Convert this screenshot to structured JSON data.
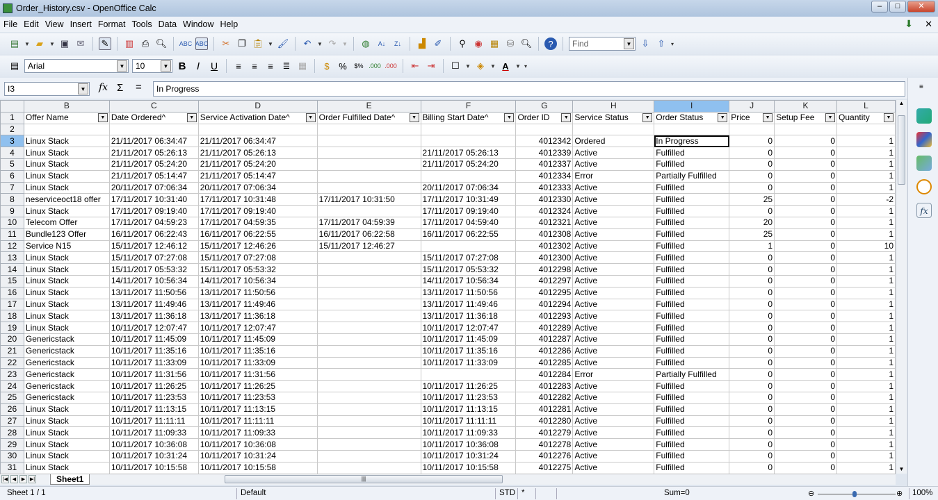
{
  "window": {
    "title": "Order_History.csv - OpenOffice Calc",
    "minimize": "–",
    "maximize": "□",
    "close": "✕"
  },
  "menu": [
    "File",
    "Edit",
    "View",
    "Insert",
    "Format",
    "Tools",
    "Data",
    "Window",
    "Help"
  ],
  "toolbar": {
    "find_placeholder": "Find",
    "font_name": "Arial",
    "font_size": "10",
    "bold": "B",
    "italic": "I",
    "underline": "U"
  },
  "formula_bar": {
    "cell_ref": "I3",
    "fx": "fx",
    "sigma": "Σ",
    "equals": "=",
    "content": "In Progress"
  },
  "columns": [
    "B",
    "C",
    "D",
    "E",
    "F",
    "G",
    "H",
    "I",
    "J",
    "K",
    "L"
  ],
  "headers": [
    "Offer Name",
    "Date Ordered^",
    "Service Activation Date^",
    "Order Fulfilled Date^",
    "Billing Start Date^",
    "Order ID",
    "Service Status",
    "Order Status",
    "Price",
    "Setup Fee",
    "Quantity"
  ],
  "rows": [
    [
      "Linux Stack",
      "21/11/2017 06:34:47",
      "21/11/2017 06:34:47",
      "",
      "",
      "4012342",
      "Ordered",
      "In Progress",
      "0",
      "0",
      "1"
    ],
    [
      "Linux Stack",
      "21/11/2017 05:26:13",
      "21/11/2017 05:26:13",
      "",
      "21/11/2017 05:26:13",
      "4012339",
      "Active",
      "Fulfilled",
      "0",
      "0",
      "1"
    ],
    [
      "Linux Stack",
      "21/11/2017 05:24:20",
      "21/11/2017 05:24:20",
      "",
      "21/11/2017 05:24:20",
      "4012337",
      "Active",
      "Fulfilled",
      "0",
      "0",
      "1"
    ],
    [
      "Linux Stack",
      "21/11/2017 05:14:47",
      "21/11/2017 05:14:47",
      "",
      "",
      "4012334",
      "Error",
      "Partially Fulfilled",
      "0",
      "0",
      "1"
    ],
    [
      "Linux Stack",
      "20/11/2017 07:06:34",
      "20/11/2017 07:06:34",
      "",
      "20/11/2017 07:06:34",
      "4012333",
      "Active",
      "Fulfilled",
      "0",
      "0",
      "1"
    ],
    [
      "neserviceoct18 offer",
      "17/11/2017 10:31:40",
      "17/11/2017 10:31:48",
      "17/11/2017 10:31:50",
      "17/11/2017 10:31:49",
      "4012330",
      "Active",
      "Fulfilled",
      "25",
      "0",
      "-2"
    ],
    [
      "Linux Stack",
      "17/11/2017 09:19:40",
      "17/11/2017 09:19:40",
      "",
      "17/11/2017 09:19:40",
      "4012324",
      "Active",
      "Fulfilled",
      "0",
      "0",
      "1"
    ],
    [
      "Telecom Offer",
      "17/11/2017 04:59:23",
      "17/11/2017 04:59:35",
      "17/11/2017 04:59:39",
      "17/11/2017 04:59:40",
      "4012321",
      "Active",
      "Fulfilled",
      "20",
      "0",
      "1"
    ],
    [
      "Bundle123 Offer",
      "16/11/2017 06:22:43",
      "16/11/2017 06:22:55",
      "16/11/2017 06:22:58",
      "16/11/2017 06:22:55",
      "4012308",
      "Active",
      "Fulfilled",
      "25",
      "0",
      "1"
    ],
    [
      "Service N15",
      "15/11/2017 12:46:12",
      "15/11/2017 12:46:26",
      "15/11/2017 12:46:27",
      "",
      "4012302",
      "Active",
      "Fulfilled",
      "1",
      "0",
      "10"
    ],
    [
      "Linux Stack",
      "15/11/2017 07:27:08",
      "15/11/2017 07:27:08",
      "",
      "15/11/2017 07:27:08",
      "4012300",
      "Active",
      "Fulfilled",
      "0",
      "0",
      "1"
    ],
    [
      "Linux Stack",
      "15/11/2017 05:53:32",
      "15/11/2017 05:53:32",
      "",
      "15/11/2017 05:53:32",
      "4012298",
      "Active",
      "Fulfilled",
      "0",
      "0",
      "1"
    ],
    [
      "Linux Stack",
      "14/11/2017 10:56:34",
      "14/11/2017 10:56:34",
      "",
      "14/11/2017 10:56:34",
      "4012297",
      "Active",
      "Fulfilled",
      "0",
      "0",
      "1"
    ],
    [
      "Linux Stack",
      "13/11/2017 11:50:56",
      "13/11/2017 11:50:56",
      "",
      "13/11/2017 11:50:56",
      "4012295",
      "Active",
      "Fulfilled",
      "0",
      "0",
      "1"
    ],
    [
      "Linux Stack",
      "13/11/2017 11:49:46",
      "13/11/2017 11:49:46",
      "",
      "13/11/2017 11:49:46",
      "4012294",
      "Active",
      "Fulfilled",
      "0",
      "0",
      "1"
    ],
    [
      "Linux Stack",
      "13/11/2017 11:36:18",
      "13/11/2017 11:36:18",
      "",
      "13/11/2017 11:36:18",
      "4012293",
      "Active",
      "Fulfilled",
      "0",
      "0",
      "1"
    ],
    [
      "Linux Stack",
      "10/11/2017 12:07:47",
      "10/11/2017 12:07:47",
      "",
      "10/11/2017 12:07:47",
      "4012289",
      "Active",
      "Fulfilled",
      "0",
      "0",
      "1"
    ],
    [
      "Genericstack",
      "10/11/2017 11:45:09",
      "10/11/2017 11:45:09",
      "",
      "10/11/2017 11:45:09",
      "4012287",
      "Active",
      "Fulfilled",
      "0",
      "0",
      "1"
    ],
    [
      "Genericstack",
      "10/11/2017 11:35:16",
      "10/11/2017 11:35:16",
      "",
      "10/11/2017 11:35:16",
      "4012286",
      "Active",
      "Fulfilled",
      "0",
      "0",
      "1"
    ],
    [
      "Genericstack",
      "10/11/2017 11:33:09",
      "10/11/2017 11:33:09",
      "",
      "10/11/2017 11:33:09",
      "4012285",
      "Active",
      "Fulfilled",
      "0",
      "0",
      "1"
    ],
    [
      "Genericstack",
      "10/11/2017 11:31:56",
      "10/11/2017 11:31:56",
      "",
      "",
      "4012284",
      "Error",
      "Partially Fulfilled",
      "0",
      "0",
      "1"
    ],
    [
      "Genericstack",
      "10/11/2017 11:26:25",
      "10/11/2017 11:26:25",
      "",
      "10/11/2017 11:26:25",
      "4012283",
      "Active",
      "Fulfilled",
      "0",
      "0",
      "1"
    ],
    [
      "Genericstack",
      "10/11/2017 11:23:53",
      "10/11/2017 11:23:53",
      "",
      "10/11/2017 11:23:53",
      "4012282",
      "Active",
      "Fulfilled",
      "0",
      "0",
      "1"
    ],
    [
      "Linux Stack",
      "10/11/2017 11:13:15",
      "10/11/2017 11:13:15",
      "",
      "10/11/2017 11:13:15",
      "4012281",
      "Active",
      "Fulfilled",
      "0",
      "0",
      "1"
    ],
    [
      "Linux Stack",
      "10/11/2017 11:11:11",
      "10/11/2017 11:11:11",
      "",
      "10/11/2017 11:11:11",
      "4012280",
      "Active",
      "Fulfilled",
      "0",
      "0",
      "1"
    ],
    [
      "Linux Stack",
      "10/11/2017 11:09:33",
      "10/11/2017 11:09:33",
      "",
      "10/11/2017 11:09:33",
      "4012279",
      "Active",
      "Fulfilled",
      "0",
      "0",
      "1"
    ],
    [
      "Linux Stack",
      "10/11/2017 10:36:08",
      "10/11/2017 10:36:08",
      "",
      "10/11/2017 10:36:08",
      "4012278",
      "Active",
      "Fulfilled",
      "0",
      "0",
      "1"
    ],
    [
      "Linux Stack",
      "10/11/2017 10:31:24",
      "10/11/2017 10:31:24",
      "",
      "10/11/2017 10:31:24",
      "4012276",
      "Active",
      "Fulfilled",
      "0",
      "0",
      "1"
    ],
    [
      "Linux Stack",
      "10/11/2017 10:15:58",
      "10/11/2017 10:15:58",
      "",
      "10/11/2017 10:15:58",
      "4012275",
      "Active",
      "Fulfilled",
      "0",
      "0",
      "1"
    ]
  ],
  "sheet_tabs": [
    "Sheet1"
  ],
  "status": {
    "sheet": "Sheet 1 / 1",
    "style": "Default",
    "mode": "STD",
    "modified": "*",
    "sum": "Sum=0",
    "zoom": "100%"
  }
}
